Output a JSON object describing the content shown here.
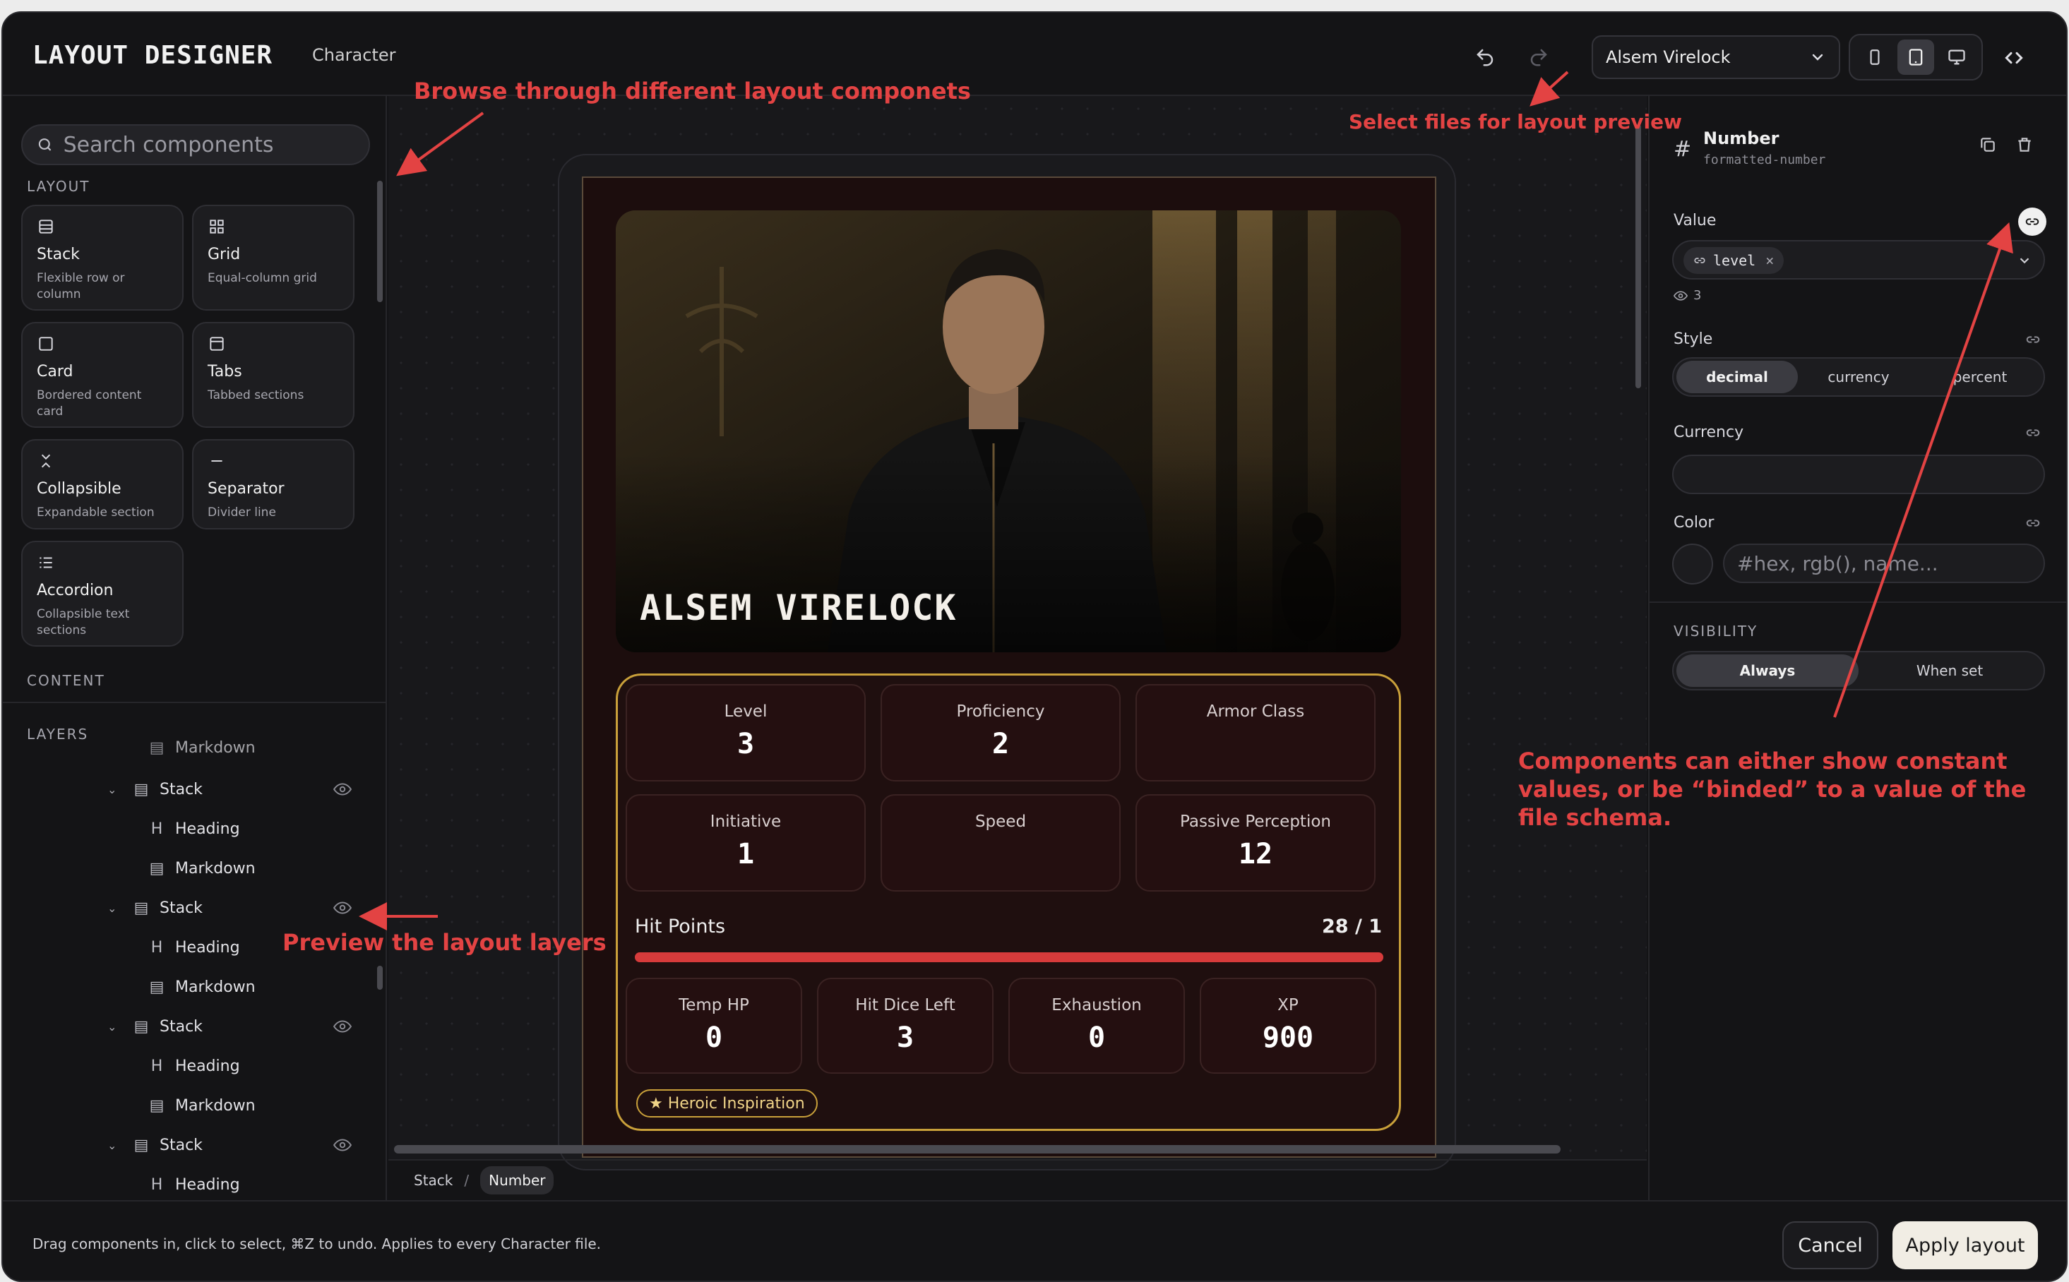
{
  "header": {
    "title": "LAYOUT DESIGNER",
    "subtitle": "Character",
    "file_select": "Alsem Virelock"
  },
  "sidebar": {
    "search_placeholder": "Search components",
    "layout_label": "LAYOUT",
    "content_label": "CONTENT",
    "components": [
      {
        "name": "Stack",
        "desc": "Flexible row or column",
        "icon": "stack-icon"
      },
      {
        "name": "Grid",
        "desc": "Equal-column grid",
        "icon": "grid-icon"
      },
      {
        "name": "Card",
        "desc": "Bordered content card",
        "icon": "card-icon"
      },
      {
        "name": "Tabs",
        "desc": "Tabbed sections",
        "icon": "tabs-icon"
      },
      {
        "name": "Collapsible",
        "desc": "Expandable section",
        "icon": "collapsible-icon"
      },
      {
        "name": "Separator",
        "desc": "Divider line",
        "icon": "separator-icon"
      },
      {
        "name": "Accordion",
        "desc": "Collapsible text sections",
        "icon": "accordion-icon"
      }
    ],
    "layers_label": "LAYERS",
    "layers": [
      {
        "label": "Markdown",
        "type": "markdown"
      },
      {
        "label": "Stack",
        "type": "stack"
      },
      {
        "label": "Heading",
        "type": "heading"
      },
      {
        "label": "Markdown",
        "type": "markdown"
      },
      {
        "label": "Stack",
        "type": "stack"
      },
      {
        "label": "Heading",
        "type": "heading"
      },
      {
        "label": "Markdown",
        "type": "markdown"
      },
      {
        "label": "Stack",
        "type": "stack"
      },
      {
        "label": "Heading",
        "type": "heading"
      },
      {
        "label": "Markdown",
        "type": "markdown"
      },
      {
        "label": "Stack",
        "type": "stack"
      },
      {
        "label": "Heading",
        "type": "heading"
      }
    ]
  },
  "preview": {
    "character_name": "ALSEM VIRELOCK",
    "stats": [
      {
        "label": "Level",
        "value": "3"
      },
      {
        "label": "Proficiency",
        "value": "2"
      },
      {
        "label": "Armor Class",
        "value": ""
      },
      {
        "label": "Initiative",
        "value": "1"
      },
      {
        "label": "Speed",
        "value": ""
      },
      {
        "label": "Passive Perception",
        "value": "12"
      }
    ],
    "hp_label": "Hit Points",
    "hp_value": "28 / 1",
    "hp_fill_fraction": 1.0,
    "small_stats": [
      {
        "label": "Temp HP",
        "value": "0"
      },
      {
        "label": "Hit Dice Left",
        "value": "3"
      },
      {
        "label": "Exhaustion",
        "value": "0"
      },
      {
        "label": "XP",
        "value": "900"
      }
    ],
    "inspiration": "★ Heroic Inspiration"
  },
  "breadcrumb": {
    "items": [
      "Stack",
      "Number"
    ],
    "separator": "/"
  },
  "panel": {
    "title": "Number",
    "subtitle": "formatted-number",
    "value_label": "Value",
    "value_chip": "level",
    "value_count": "3",
    "style_label": "Style",
    "style_options": [
      "decimal",
      "currency",
      "percent"
    ],
    "style_active": "decimal",
    "currency_label": "Currency",
    "color_label": "Color",
    "color_placeholder": "#hex, rgb(), name...",
    "visibility_label": "VISIBILITY",
    "visibility_options": [
      "Always",
      "When set"
    ]
  },
  "footer": {
    "hint": "Drag components in, click to select, ⌘Z to undo. Applies to every Character file.",
    "cancel": "Cancel",
    "apply": "Apply layout"
  },
  "annotations": {
    "browse": "Browse through different layout componets",
    "select_files": "Select files for layout preview",
    "preview_layers": "Preview the layout layers",
    "binding": "Components can either show constant values, or be “binded” to a value of the file schema."
  },
  "colors": {
    "annotation": "#e34343",
    "hp_bar": "#d63b3b",
    "card_border": "#c9a03a"
  }
}
